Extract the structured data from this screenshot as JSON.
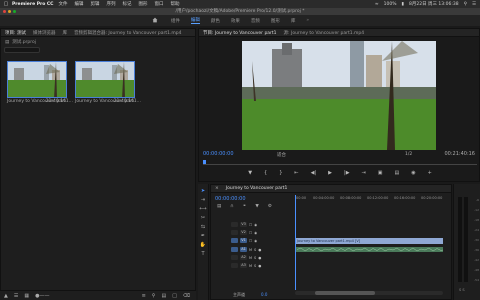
{
  "menubar": {
    "app": "Premiere Pro CC",
    "items": [
      "文件",
      "编辑",
      "剪辑",
      "序列",
      "标记",
      "图形",
      "窗口",
      "帮助"
    ],
    "status": {
      "battery": "100%",
      "datetime": "8月22日 周三 13:06:38"
    }
  },
  "window": {
    "title": "/用户/pochaozi/文稿/Adobe/Premiere Pro/12.0/测试.prproj *"
  },
  "workspaces": {
    "items": [
      "组件",
      "编辑",
      "颜色",
      "效果",
      "音频",
      "图形",
      "库"
    ],
    "active": 1,
    "more": "»"
  },
  "project_panel": {
    "tabs": [
      "项目: 测试",
      "媒体浏览器",
      "库",
      "信息",
      "效果",
      "标记",
      "历史记录",
      "音频剪辑混合器: Journey to Vancouver part1.mp4"
    ],
    "active_tab": 0,
    "file": "测试.prproj",
    "item_count": "2 个项",
    "clips": [
      {
        "name": "Journey to Vancouver part1...",
        "duration": "21:40:16"
      },
      {
        "name": "Journey to Vancouver part1...",
        "duration": "21:40:16"
      }
    ]
  },
  "program": {
    "tabs": [
      "节目: Journey to Vancouver part1",
      "源: Journey to Vancouver part1.mp4"
    ],
    "timecode": "00:00:00:00",
    "fit": "适合",
    "resolution": "1/2",
    "duration": "00:21:40:16"
  },
  "timeline": {
    "tab": "Journey to Vancouver part1",
    "timecode": "00:00:00:00",
    "ruler": [
      "00:00",
      "00:04:00:00",
      "00:08:00:00",
      "00:12:00:00",
      "00:16:00:00",
      "00:20:00:00"
    ],
    "video_tracks": [
      "V3",
      "V2",
      "V1"
    ],
    "audio_tracks": [
      "A1",
      "A2",
      "A3"
    ],
    "v1_clip": "Journey to Vancouver part1.mp4 [V]",
    "master": "主声道",
    "master_value": "0.0"
  },
  "meter": {
    "labels": [
      "-6",
      "-12",
      "-18",
      "-24",
      "-30",
      "-36",
      "-42",
      "-48",
      "-54"
    ],
    "bottom": "S S"
  },
  "colors": {
    "accent": "#4a90ff",
    "clip_video": "#8fa8d4",
    "clip_audio": "#4a7a5a"
  }
}
